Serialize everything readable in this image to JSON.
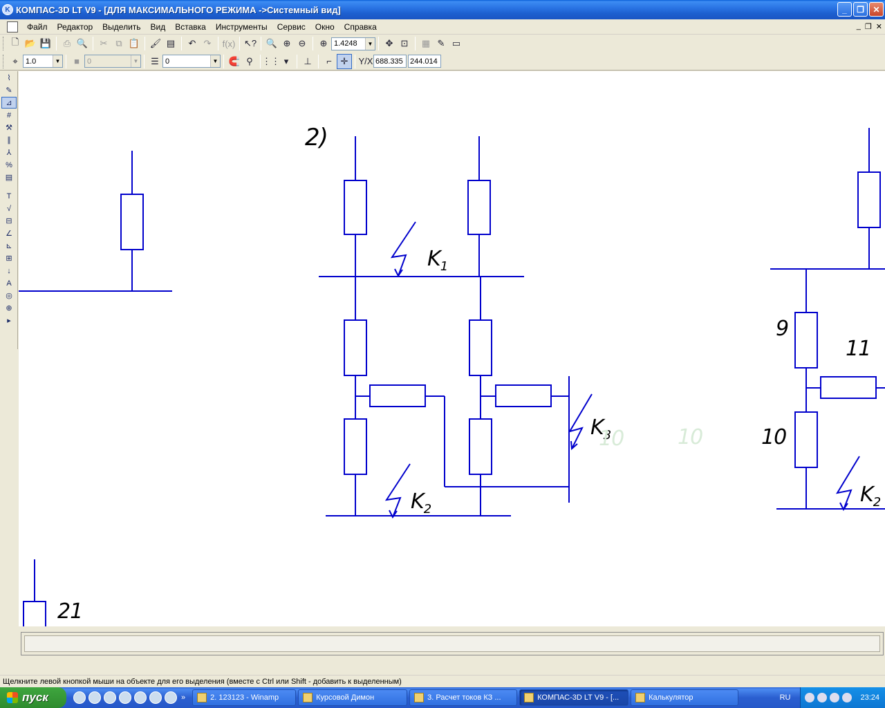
{
  "window": {
    "title": "КОМПАС-3D LT V9 - [ДЛЯ МАКСИМАЛЬНОГО РЕЖИМА ->Системный вид]"
  },
  "menu": [
    "Файл",
    "Редактор",
    "Выделить",
    "Вид",
    "Вставка",
    "Инструменты",
    "Сервис",
    "Окно",
    "Справка"
  ],
  "toolbar1": {
    "zoom_value": "1.4248"
  },
  "toolbar2": {
    "step_value": "1.0",
    "layer_value": "0",
    "style_value": "0",
    "coord_label": "Y/X",
    "coord_x": "688.335",
    "coord_y": "244.014"
  },
  "drawing": {
    "label_g": "2)",
    "k1": "K",
    "k1_sub": "1",
    "k2": "K",
    "k2_sub": "2",
    "k3": "K",
    "k3_sub": "3",
    "k2_right": "K",
    "k2_right_sub": "2",
    "n9": "9",
    "n10": "10",
    "n11": "11",
    "n21": "21",
    "ghost1": "10",
    "ghost2": "10"
  },
  "colors": {
    "line": "#0000cc",
    "canvas": "#ffffff"
  },
  "status": {
    "hint": "Щелкните левой кнопкой мыши на объекте для его выделения (вместе с Ctrl или Shift - добавить к выделенным)"
  },
  "taskbar": {
    "start": "пуск",
    "more": "»",
    "tasks": [
      "2. 123123 - Winamp",
      "Курсовой Димон",
      "3. Расчет токов КЗ ...",
      "КОМПАС-3D LT V9 - [...",
      "Калькулятор"
    ],
    "lang": "RU",
    "clock": "23:24"
  }
}
